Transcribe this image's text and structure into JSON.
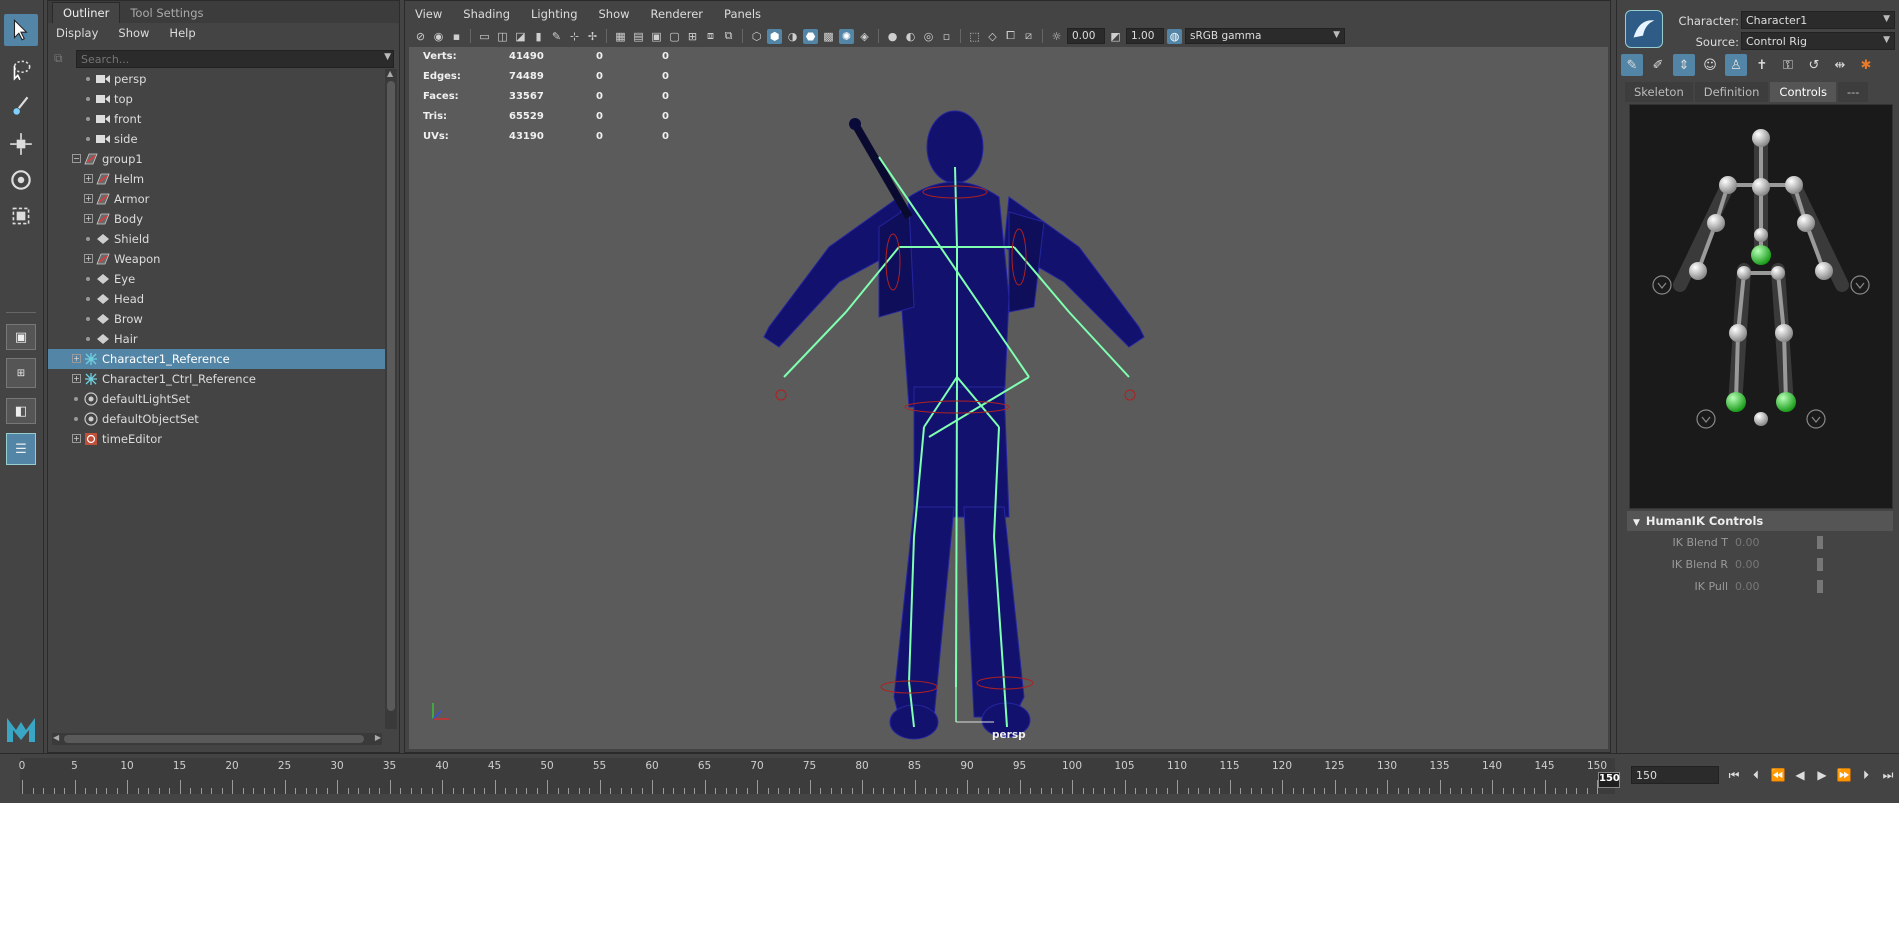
{
  "outliner": {
    "tabs": [
      "Outliner",
      "Tool Settings"
    ],
    "menu": [
      "Display",
      "Show",
      "Help"
    ],
    "search_placeholder": "Search...",
    "items": [
      {
        "label": "persp",
        "type": "camera",
        "depth": 1
      },
      {
        "label": "top",
        "type": "camera",
        "depth": 1
      },
      {
        "label": "front",
        "type": "camera",
        "depth": 1
      },
      {
        "label": "side",
        "type": "camera",
        "depth": 1
      },
      {
        "label": "group1",
        "type": "transform",
        "depth": 0,
        "expand": "−"
      },
      {
        "label": "Helm",
        "type": "transform",
        "depth": 1,
        "expand": "+"
      },
      {
        "label": "Armor",
        "type": "transform",
        "depth": 1,
        "expand": "+"
      },
      {
        "label": "Body",
        "type": "transform",
        "depth": 1,
        "expand": "+"
      },
      {
        "label": "Shield",
        "type": "joint",
        "depth": 1
      },
      {
        "label": "Weapon",
        "type": "transform",
        "depth": 1,
        "expand": "+"
      },
      {
        "label": "Eye",
        "type": "joint",
        "depth": 1
      },
      {
        "label": "Head",
        "type": "joint",
        "depth": 1
      },
      {
        "label": "Brow",
        "type": "joint",
        "depth": 1
      },
      {
        "label": "Hair",
        "type": "joint",
        "depth": 1
      },
      {
        "label": "Character1_Reference",
        "type": "hik",
        "depth": 0,
        "expand": "+",
        "selected": true
      },
      {
        "label": "Character1_Ctrl_Reference",
        "type": "hik",
        "depth": 0,
        "expand": "+"
      },
      {
        "label": "defaultLightSet",
        "type": "set",
        "depth": 0
      },
      {
        "label": "defaultObjectSet",
        "type": "set",
        "depth": 0
      },
      {
        "label": "timeEditor",
        "type": "timeeditor",
        "depth": 0,
        "expand": "+"
      }
    ]
  },
  "viewport": {
    "menu": [
      "View",
      "Shading",
      "Lighting",
      "Show",
      "Renderer",
      "Panels"
    ],
    "exposure": "0.00",
    "gamma": "1.00",
    "color_space": "sRGB gamma",
    "camera_label": "persp",
    "hud": [
      {
        "label": "Verts:",
        "v1": "41490",
        "v2": "0",
        "v3": "0"
      },
      {
        "label": "Edges:",
        "v1": "74489",
        "v2": "0",
        "v3": "0"
      },
      {
        "label": "Faces:",
        "v1": "33567",
        "v2": "0",
        "v3": "0"
      },
      {
        "label": "Tris:",
        "v1": "65529",
        "v2": "0",
        "v3": "0"
      },
      {
        "label": "UVs:",
        "v1": "43190",
        "v2": "0",
        "v3": "0"
      }
    ]
  },
  "hik": {
    "character_label": "Character:",
    "character_value": "Character1",
    "source_label": "Source:",
    "source_value": "Control Rig",
    "tabs": [
      "Skeleton",
      "Definition",
      "Controls",
      "---"
    ],
    "active_tab": "Controls",
    "controls_header": "HumanIK Controls",
    "sliders": [
      {
        "label": "IK Blend T",
        "value": "0.00"
      },
      {
        "label": "IK Blend R",
        "value": "0.00"
      },
      {
        "label": "IK Pull",
        "value": "0.00"
      }
    ]
  },
  "timeline": {
    "ticks": [
      0,
      5,
      10,
      15,
      20,
      25,
      30,
      35,
      40,
      45,
      50,
      55,
      60,
      65,
      70,
      75,
      80,
      85,
      90,
      95,
      100,
      105,
      110,
      115,
      120,
      125,
      130,
      135,
      140,
      145,
      150
    ],
    "current_frame": "150",
    "end_frame": "150"
  },
  "colors": {
    "selection": "#5285a6",
    "skeleton": "#7fffb0",
    "mesh": "#10106a",
    "hik_active": "#2ecc40"
  }
}
